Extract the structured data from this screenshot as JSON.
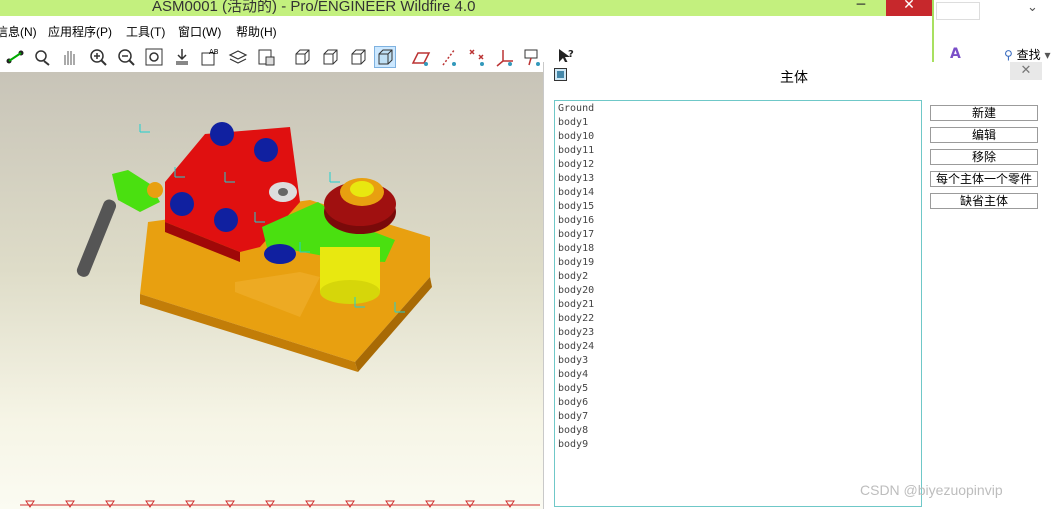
{
  "window": {
    "title": "ASM0001 (活动的) - Pro/ENGINEER Wildfire 4.0",
    "minimize": "─",
    "close": "✕"
  },
  "menubar": {
    "items": [
      "信息(N)",
      "应用程序(P)",
      "工具(T)",
      "窗口(W)",
      "帮助(H)"
    ]
  },
  "sideapp": {
    "find_label": "查找",
    "find_icon": "binoculars-icon"
  },
  "dialog": {
    "title": "主体",
    "close": "✕",
    "bodies": [
      "Ground",
      "body1",
      "body10",
      "body11",
      "body12",
      "body13",
      "body14",
      "body15",
      "body16",
      "body17",
      "body18",
      "body19",
      "body2",
      "body20",
      "body21",
      "body22",
      "body23",
      "body24",
      "body3",
      "body4",
      "body5",
      "body6",
      "body7",
      "body8",
      "body9"
    ],
    "buttons": {
      "new": "新建",
      "edit": "编辑",
      "remove": "移除",
      "one_per_part": "每个主体一个零件",
      "default": "缺省主体"
    }
  },
  "colors": {
    "titlebar": "#c3f07e",
    "close_red": "#c7282c",
    "list_border": "#6fc8c8",
    "part_red": "#e01010",
    "part_orange": "#e8a010",
    "part_green": "#4ae010",
    "part_yellow": "#e8e810",
    "part_blue": "#1020a0"
  },
  "watermark": "CSDN @biyezuopinvip"
}
